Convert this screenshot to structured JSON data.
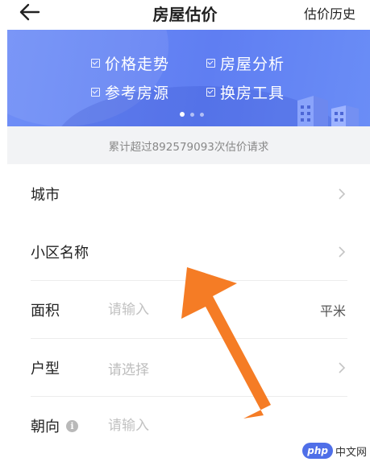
{
  "header": {
    "title": "房屋估价",
    "history_label": "估价历史"
  },
  "banner": {
    "features": [
      "价格走势",
      "房屋分析",
      "参考房源",
      "换房工具"
    ],
    "page_count": 3,
    "active_page": 0,
    "colors": {
      "start": "#6f8ef7",
      "end": "#5f7ef2"
    }
  },
  "stats": {
    "text": "累计超过892579093次估价请求"
  },
  "form": {
    "city_label": "城市",
    "community_label": "小区名称",
    "area_label": "面积",
    "area_placeholder": "请输入",
    "area_unit": "平米",
    "layout_label": "户型",
    "layout_placeholder": "请选择",
    "orientation_label": "朝向",
    "orientation_placeholder": "请输入"
  },
  "annotation": {
    "arrow_color": "#f57c25"
  },
  "watermark": {
    "badge": "php",
    "site": "中文网"
  }
}
